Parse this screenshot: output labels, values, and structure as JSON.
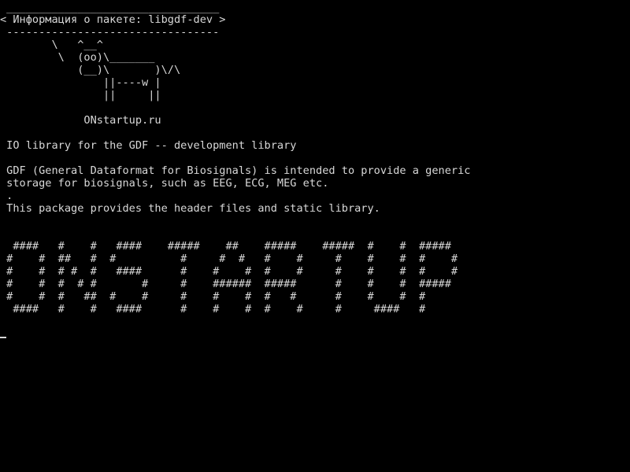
{
  "terminal": {
    "cowsay": {
      "border_top": " _________________________________",
      "message": "< Информация о пакете: libgdf-dev >",
      "border_bottom": " ---------------------------------",
      "cow": [
        "        \\   ^__^",
        "         \\  (oo)\\_______",
        "            (__)\\       )\\/\\",
        "                ||----w |",
        "                ||     ||"
      ],
      "credit": "             ONstartup.ru"
    },
    "package": {
      "summary": " IO library for the GDF -- development library",
      "description": [
        " GDF (General Dataformat for Biosignals) is intended to provide a generic",
        " storage for biosignals, such as EEG, ECG, MEG etc.",
        " .",
        " This package provides the header files and static library."
      ]
    },
    "banner": [
      "  ####   #    #   ####    #####    ##    #####    #####  #    #  #####",
      " #    #  ##   #  #          #     #  #   #    #     #    #    #  #    #",
      " #    #  # #  #   ####      #    #    #  #    #     #    #    #  #    #",
      " #    #  #  # #       #     #    ######  #####      #    #    #  #####",
      " #    #  #   ##  #    #     #    #    #  #   #      #    #    #  #",
      "  ####   #    #   ####      #    #    #  #    #     #     ####   #"
    ]
  }
}
